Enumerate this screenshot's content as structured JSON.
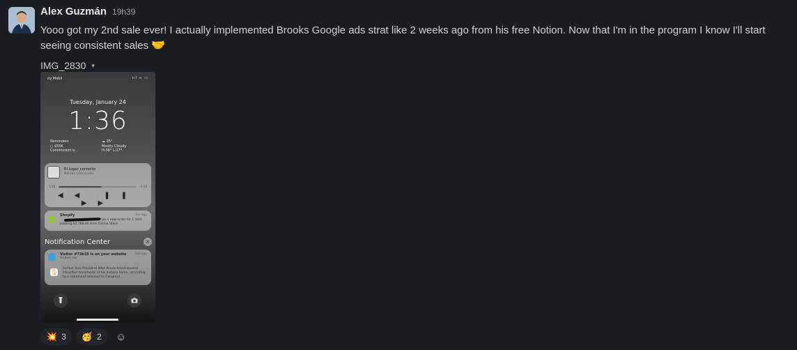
{
  "message": {
    "author": "Alex Guzmán",
    "time": "19h39",
    "text": "Yooo got my 2nd sale ever! I actually implemented Brooks Google ads strat like 2 weeks ago from his free Notion. Now that I'm in the program I know I'll start seeing consistent sales",
    "text_emoji": "🤝",
    "attachment_name": "IMG_2830",
    "attachment_caret": "▾"
  },
  "phone": {
    "carrier": "ıty Mobil",
    "status_icons": "ııl ≈ ▭",
    "date": "Tuesday, January 24",
    "time": "1:36",
    "widget_left": [
      "Reminders",
      "○ $50K",
      "Commission b..."
    ],
    "widget_right": [
      "☁ 35°",
      "Mostly Cloudy",
      "H:36° L:27°"
    ],
    "music": {
      "title": "El lugar correcto",
      "artist": "Natalia Lafourcade",
      "elapsed": "1:18",
      "remaining": "-1:16",
      "progress": 0.55,
      "controls": "◀◀ ❚❚ ▶▶"
    },
    "shopify": {
      "app": "Shopify",
      "ago": "3m ago",
      "body": "has a new order for 1 item totaling $3,768.90 from Online Store."
    },
    "notification_center": "Notification Center",
    "nc_close": "×",
    "visitor": {
      "title": "Visitor #73b35 is on your website",
      "subtitle": "Visitors Inc",
      "ago": "5m ago"
    },
    "news": {
      "body": "Former Vice President Mike Pence found several classified documents at his Indiana home, according to a statement released to Congress."
    },
    "flashlight_icon": "flashlight-icon",
    "camera_icon": "camera-icon"
  },
  "reactions": [
    {
      "emoji": "💥",
      "count": "3"
    },
    {
      "emoji": "🥳",
      "count": "2"
    }
  ],
  "add_reaction_icon": "☺"
}
